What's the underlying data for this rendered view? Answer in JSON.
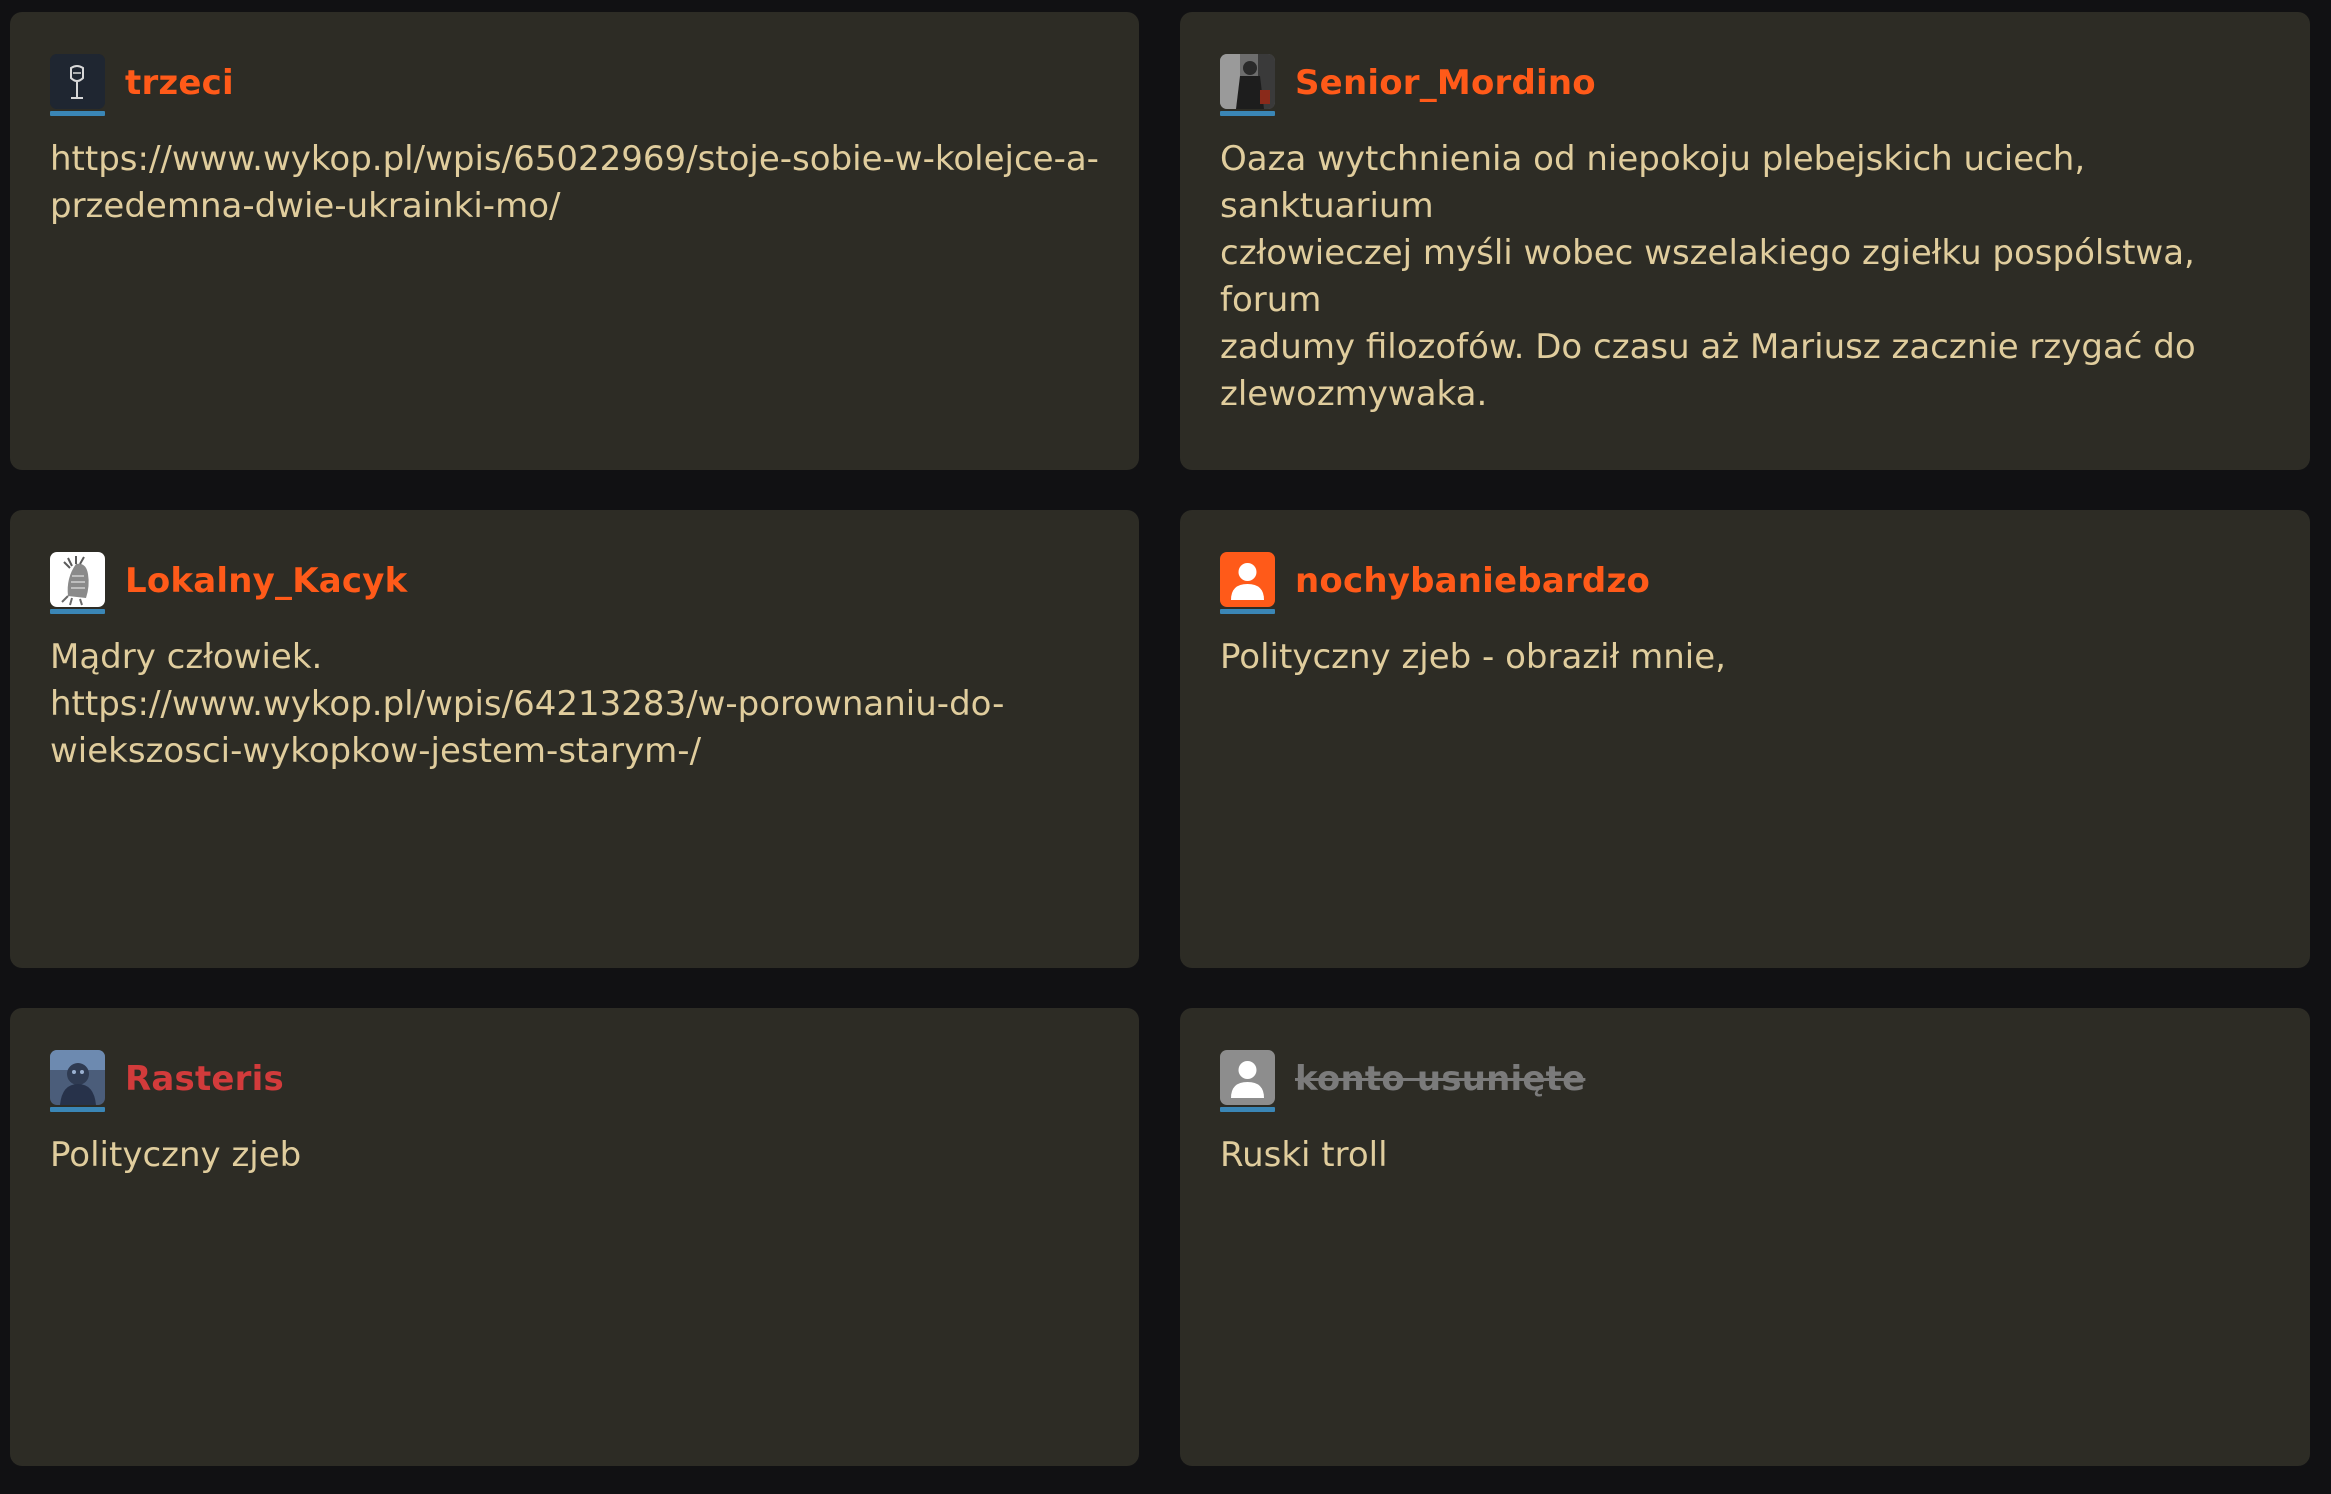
{
  "comments": [
    {
      "username": "trzeci",
      "avatar_icon": "wine-glass-avatar-icon",
      "lines": [
        "https://www.wykop.pl/wpis/65022969/stoje-sobie-w-kolejce-a-",
        "przedemna-dwie-ukrainki-mo/"
      ]
    },
    {
      "username": "Senior_Mordino",
      "avatar_icon": "photo-avatar-icon",
      "lines": [
        "Oaza wytchnienia od niepokoju plebejskich uciech, sanktuarium",
        "człowieczej myśli wobec wszelakiego zgiełku pospólstwa, forum",
        "zadumy filozofów. Do czasu aż Mariusz zacznie rzygać do",
        "zlewozmywaka."
      ]
    },
    {
      "username": "Lokalny_Kacyk",
      "avatar_icon": "headdress-avatar-icon",
      "lines": [
        "Mądry człowiek.",
        "https://www.wykop.pl/wpis/64213283/w-porownaniu-do-",
        "wiekszosci-wykopkow-jestem-starym-/"
      ]
    },
    {
      "username": "nochybaniebardzo",
      "avatar_icon": "default-user-avatar-icon",
      "lines": [
        "Polityczny zjeb - obraził mnie,"
      ]
    },
    {
      "username": "Rasteris",
      "avatar_icon": "photo-avatar-icon",
      "lines": [
        "Polityczny zjeb"
      ]
    },
    {
      "username": "konto usunięte",
      "avatar_icon": "deleted-user-avatar-icon",
      "lines": [
        "Ruski troll"
      ]
    }
  ],
  "colors": {
    "page_background": "#111113",
    "card_background": "#2d2c25",
    "username_orange": "#ff5a19",
    "username_red": "#d23b3b",
    "username_deleted": "#7b7b7b",
    "text": "#e0cd9d",
    "avatar_underline": "#3a86b6"
  }
}
